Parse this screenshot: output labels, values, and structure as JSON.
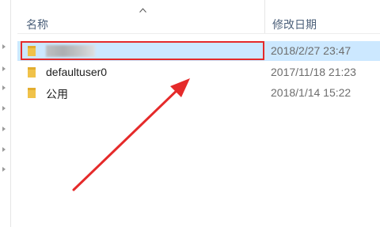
{
  "header": {
    "name_label": "名称",
    "date_label": "修改日期"
  },
  "rows": [
    {
      "name": "",
      "date": "2018/2/27 23:47",
      "selected": true,
      "icon": "folder-icon"
    },
    {
      "name": "defaultuser0",
      "date": "2017/11/18 21:23",
      "selected": false,
      "icon": "folder-icon"
    },
    {
      "name": "公用",
      "date": "2018/1/14 15:22",
      "selected": false,
      "icon": "folder-icon"
    }
  ],
  "colors": {
    "selection": "#cce8ff",
    "annotation": "#e52a2a",
    "folder": "#f0c24a"
  }
}
